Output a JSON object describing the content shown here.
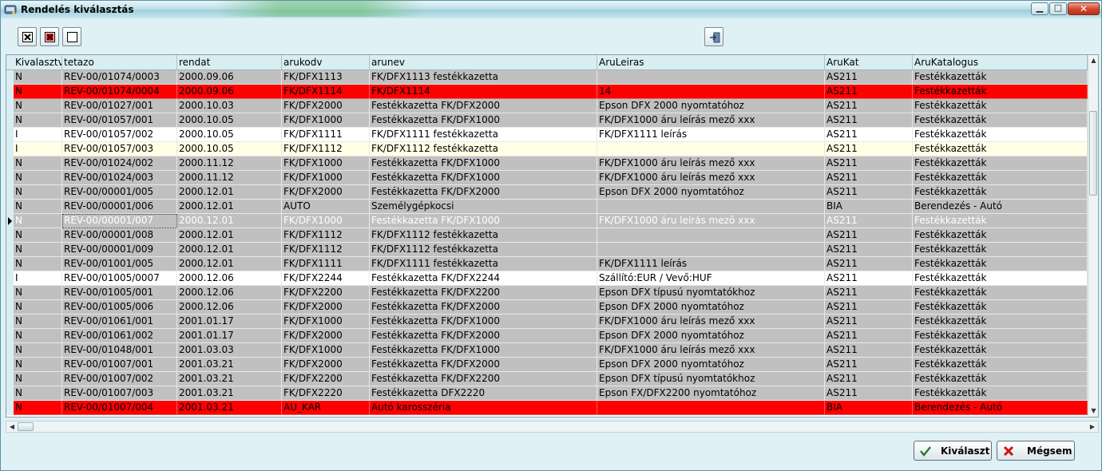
{
  "window": {
    "title": "Rendelés kiválasztás"
  },
  "toolbar": {
    "buttons": [
      {
        "name": "select-all-button",
        "icon": "checkbox-checked-icon"
      },
      {
        "name": "deselect-all-button",
        "icon": "checkbox-red-x-icon"
      },
      {
        "name": "clear-selection-button",
        "icon": "checkbox-empty-icon"
      }
    ],
    "exit_icon": "exit-door-icon"
  },
  "grid": {
    "columns": [
      "Kivalasztva",
      "tetazo",
      "rendat",
      "arukodv",
      "arunev",
      "AruLeiras",
      "AruKat",
      "AruKatalogus"
    ],
    "current_row_index": 10,
    "rows": [
      {
        "style": "gray",
        "cells": [
          "N",
          "REV-00/01074/0003",
          "2000.09.06",
          "FK/DFX1113",
          "FK/DFX1113 festékkazetta",
          "",
          "AS211",
          "Festékkazetták"
        ]
      },
      {
        "style": "red",
        "cells": [
          "N",
          "REV-00/01074/0004",
          "2000.09.06",
          "FK/DFX1114",
          "FK/DFX1114",
          "14",
          "AS211",
          "Festékkazetták"
        ]
      },
      {
        "style": "gray",
        "cells": [
          "N",
          "REV-00/01027/001",
          "2000.10.03",
          "FK/DFX2000",
          "Festékkazetta FK/DFX2000",
          "Epson DFX 2000 nyomtatóhoz",
          "AS211",
          "Festékkazetták"
        ]
      },
      {
        "style": "gray",
        "cells": [
          "N",
          "REV-00/01057/001",
          "2000.10.05",
          "FK/DFX1000",
          "Festékkazetta FK/DFX1000",
          "FK/DFX1000 áru leírás mező xxx",
          "AS211",
          "Festékkazetták"
        ]
      },
      {
        "style": "white",
        "cells": [
          "I",
          "REV-00/01057/002",
          "2000.10.05",
          "FK/DFX1111",
          "FK/DFX1111 festékkazetta",
          "FK/DFX1111 leírás",
          "AS211",
          "Festékkazetták"
        ]
      },
      {
        "style": "cream",
        "cells": [
          "I",
          "REV-00/01057/003",
          "2000.10.05",
          "FK/DFX1112",
          "FK/DFX1112 festékkazetta",
          "",
          "AS211",
          "Festékkazetták"
        ]
      },
      {
        "style": "gray",
        "cells": [
          "N",
          "REV-00/01024/002",
          "2000.11.12",
          "FK/DFX1000",
          "Festékkazetta FK/DFX1000",
          "FK/DFX1000 áru leírás mező xxx",
          "AS211",
          "Festékkazetták"
        ]
      },
      {
        "style": "gray",
        "cells": [
          "N",
          "REV-00/01024/003",
          "2000.11.12",
          "FK/DFX1000",
          "Festékkazetta FK/DFX1000",
          "FK/DFX1000 áru leírás mező xxx",
          "AS211",
          "Festékkazetták"
        ]
      },
      {
        "style": "gray",
        "cells": [
          "N",
          "REV-00/00001/005",
          "2000.12.01",
          "FK/DFX2000",
          "Festékkazetta FK/DFX2000",
          "Epson DFX 2000 nyomtatóhoz",
          "AS211",
          "Festékkazetták"
        ]
      },
      {
        "style": "gray",
        "cells": [
          "N",
          "REV-00/00001/006",
          "2000.12.01",
          "AUTO",
          "Személygépkocsi",
          "",
          "BIA",
          "Berendezés - Autó"
        ]
      },
      {
        "style": "selected",
        "cells": [
          "N",
          "REV-00/00001/007",
          "2000.12.01",
          "FK/DFX1000",
          "Festékkazetta FK/DFX1000",
          "FK/DFX1000 áru leírás mező xxx",
          "AS211",
          "Festékkazetták"
        ]
      },
      {
        "style": "gray",
        "cells": [
          "N",
          "REV-00/00001/008",
          "2000.12.01",
          "FK/DFX1112",
          "FK/DFX1112 festékkazetta",
          "",
          "AS211",
          "Festékkazetták"
        ]
      },
      {
        "style": "gray",
        "cells": [
          "N",
          "REV-00/00001/009",
          "2000.12.01",
          "FK/DFX1112",
          "FK/DFX1112 festékkazetta",
          "",
          "AS211",
          "Festékkazetták"
        ]
      },
      {
        "style": "gray",
        "cells": [
          "N",
          "REV-00/01001/005",
          "2000.12.01",
          "FK/DFX1111",
          "FK/DFX1111 festékkazetta",
          "FK/DFX1111 leírás",
          "AS211",
          "Festékkazetták"
        ]
      },
      {
        "style": "white",
        "cells": [
          "I",
          "REV-00/01005/0007",
          "2000.12.06",
          "FK/DFX2244",
          "Festékkazetta FK/DFX2244",
          "Szállító:EUR / Vevő:HUF",
          "AS211",
          "Festékkazetták"
        ]
      },
      {
        "style": "gray",
        "cells": [
          "N",
          "REV-00/01005/001",
          "2000.12.06",
          "FK/DFX2200",
          "Festékkazetta FK/DFX2200",
          "Epson DFX típusú nyomtatókhoz",
          "AS211",
          "Festékkazetták"
        ]
      },
      {
        "style": "gray",
        "cells": [
          "N",
          "REV-00/01005/006",
          "2000.12.06",
          "FK/DFX2000",
          "Festékkazetta FK/DFX2000",
          "Epson DFX 2000 nyomtatóhoz",
          "AS211",
          "Festékkazetták"
        ]
      },
      {
        "style": "gray",
        "cells": [
          "N",
          "REV-00/01061/001",
          "2001.01.17",
          "FK/DFX1000",
          "Festékkazetta FK/DFX1000",
          "FK/DFX1000 áru leírás mező xxx",
          "AS211",
          "Festékkazetták"
        ]
      },
      {
        "style": "gray",
        "cells": [
          "N",
          "REV-00/01061/002",
          "2001.01.17",
          "FK/DFX2000",
          "Festékkazetta FK/DFX2000",
          "Epson DFX 2000 nyomtatóhoz",
          "AS211",
          "Festékkazetták"
        ]
      },
      {
        "style": "gray",
        "cells": [
          "N",
          "REV-00/01048/001",
          "2001.03.03",
          "FK/DFX1000",
          "Festékkazetta FK/DFX1000",
          "FK/DFX1000 áru leírás mező xxx",
          "AS211",
          "Festékkazetták"
        ]
      },
      {
        "style": "gray",
        "cells": [
          "N",
          "REV-00/01007/001",
          "2001.03.21",
          "FK/DFX2000",
          "Festékkazetta FK/DFX2000",
          "Epson DFX 2000 nyomtatóhoz",
          "AS211",
          "Festékkazetták"
        ]
      },
      {
        "style": "gray",
        "cells": [
          "N",
          "REV-00/01007/002",
          "2001.03.21",
          "FK/DFX2200",
          "Festékkazetta FK/DFX2200",
          "Epson DFX típusú nyomtatókhoz",
          "AS211",
          "Festékkazetták"
        ]
      },
      {
        "style": "gray",
        "cells": [
          "N",
          "REV-00/01007/003",
          "2001.03.21",
          "FK/DFX2220",
          "Festékkazetta DFX2220",
          "Epson FX/DFX2200 nyomtatóhoz",
          "AS211",
          "Festékkazetták"
        ]
      },
      {
        "style": "red",
        "cells": [
          "N",
          "REV-00/01007/004",
          "2001.03.21",
          "AU_KAR",
          "Autó karosszéria",
          "",
          "BIA",
          "Berendezés - Autó"
        ]
      }
    ]
  },
  "row_colors": {
    "gray": "#c0c0c0",
    "red": "#ff0000",
    "white": "#ffffff",
    "cream": "#ffffe6",
    "selected": "#c0c0c0"
  },
  "buttons": {
    "select_label": "Kiválaszt",
    "cancel_label": "Mégsem"
  }
}
